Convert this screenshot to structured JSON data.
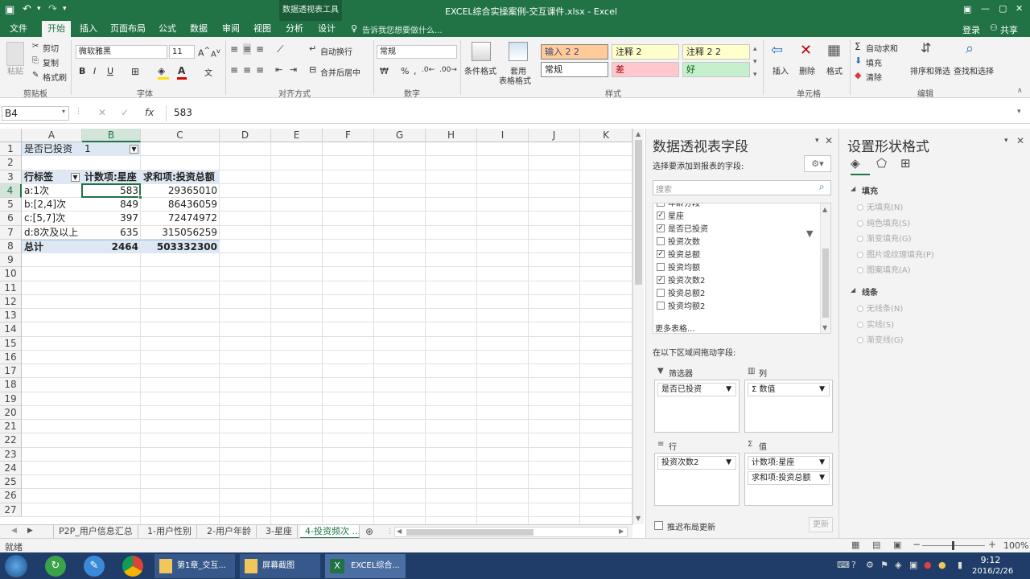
{
  "titlebar": {
    "title": "EXCEL综合实操案例-交互课件.xlsx - Excel",
    "context_tab": "数据透视表工具",
    "window_controls": [
      "▣",
      "—",
      "▢",
      "✕"
    ]
  },
  "ribbon_tabs": [
    "文件",
    "开始",
    "插入",
    "页面布局",
    "公式",
    "数据",
    "审阅",
    "视图",
    "分析",
    "设计"
  ],
  "tell_me": "告诉我您想要做什么...",
  "account": {
    "login": "登录",
    "share": "共享"
  },
  "ribbon": {
    "clipboard": {
      "paste": "粘贴",
      "cut": "剪切",
      "copy": "复制",
      "format_painter": "格式刷",
      "group": "剪贴板"
    },
    "font": {
      "name": "微软雅黑",
      "size": "11",
      "bold": "B",
      "italic": "I",
      "underline": "U",
      "group": "字体"
    },
    "alignment": {
      "wrap": "自动换行",
      "merge": "合并后居中",
      "group": "对齐方式"
    },
    "number": {
      "format": "常规",
      "group": "数字"
    },
    "styles": {
      "conditional": "条件格式",
      "table_format_1": "套用",
      "table_format_2": "表格格式",
      "group": "样式",
      "cells": [
        "输入 2 2",
        "注释 2",
        "注释 2 2",
        "常规",
        "差",
        "好"
      ]
    },
    "cells": {
      "insert": "插入",
      "delete": "删除",
      "format": "格式",
      "group": "单元格"
    },
    "editing": {
      "autosum": "自动求和",
      "fill": "填充",
      "clear": "清除",
      "sort": "排序和筛选",
      "find": "查找和选择",
      "group": "编辑"
    }
  },
  "formula_bar": {
    "name_box": "B4",
    "value": "583",
    "fx": "fx"
  },
  "columns": [
    "A",
    "B",
    "C",
    "D",
    "E",
    "F",
    "G",
    "H",
    "I",
    "J",
    "K"
  ],
  "rows": [
    "1",
    "2",
    "3",
    "4",
    "5",
    "6",
    "7",
    "8",
    "9",
    "10",
    "11",
    "12",
    "13",
    "14",
    "15",
    "16",
    "17",
    "18",
    "19",
    "20",
    "21",
    "22",
    "23",
    "24",
    "25",
    "26",
    "27"
  ],
  "sheet": {
    "filter_label": "是否已投资",
    "filter_value": "1",
    "headers": [
      "行标签",
      "计数项:星座",
      "求和项:投资总额"
    ],
    "data_rows": [
      [
        "a:1次",
        "583",
        "29365010"
      ],
      [
        "b:[2,4]次",
        "849",
        "86436059"
      ],
      [
        "c:[5,7]次",
        "397",
        "72474972"
      ],
      [
        "d:8次及以上",
        "635",
        "315056259"
      ]
    ],
    "total": [
      "总计",
      "2464",
      "503332300"
    ]
  },
  "sheet_tabs": [
    "P2P_用户信息汇总",
    "1-用户性别",
    "2-用户年龄",
    "3-星座",
    "4-投资频次 ..."
  ],
  "status": {
    "ready": "就绪",
    "zoom": "100%"
  },
  "pivot_pane": {
    "title": "数据透视表字段",
    "subtitle": "选择要添加到报表的字段:",
    "search_placeholder": "搜索",
    "fields": [
      {
        "name": "年龄分段",
        "checked": false
      },
      {
        "name": "星座",
        "checked": true
      },
      {
        "name": "是否已投资",
        "checked": true
      },
      {
        "name": "投资次数",
        "checked": false
      },
      {
        "name": "投资总额",
        "checked": true
      },
      {
        "name": "投资均额",
        "checked": false
      },
      {
        "name": "投资次数2",
        "checked": true
      },
      {
        "name": "投资总额2",
        "checked": false
      },
      {
        "name": "投资均额2",
        "checked": false
      }
    ],
    "more_tables": "更多表格...",
    "drag_hint": "在以下区域间拖动字段:",
    "areas": {
      "filters": {
        "label": "筛选器",
        "items": [
          "是否已投资"
        ]
      },
      "columns": {
        "label": "列",
        "items": [
          "数值"
        ]
      },
      "rows": {
        "label": "行",
        "items": [
          "投资次数2"
        ]
      },
      "values": {
        "label": "值",
        "items": [
          "计数项:星座",
          "求和项:投资总额"
        ]
      }
    },
    "defer_update": "推迟布局更新",
    "update_button": "更新"
  },
  "format_pane": {
    "title": "设置形状格式",
    "fill_section": "填充",
    "fill_options": [
      "无填充(N)",
      "纯色填充(S)",
      "渐变填充(G)",
      "图片或纹理填充(P)",
      "图案填充(A)"
    ],
    "line_section": "线条",
    "line_options": [
      "无线条(N)",
      "实线(S)",
      "渐变线(G)"
    ]
  },
  "taskbar": {
    "items": [
      "第1章_交互...",
      "屏幕截图",
      "EXCEL综合..."
    ],
    "time": "9:12",
    "date": "2016/2/26"
  }
}
